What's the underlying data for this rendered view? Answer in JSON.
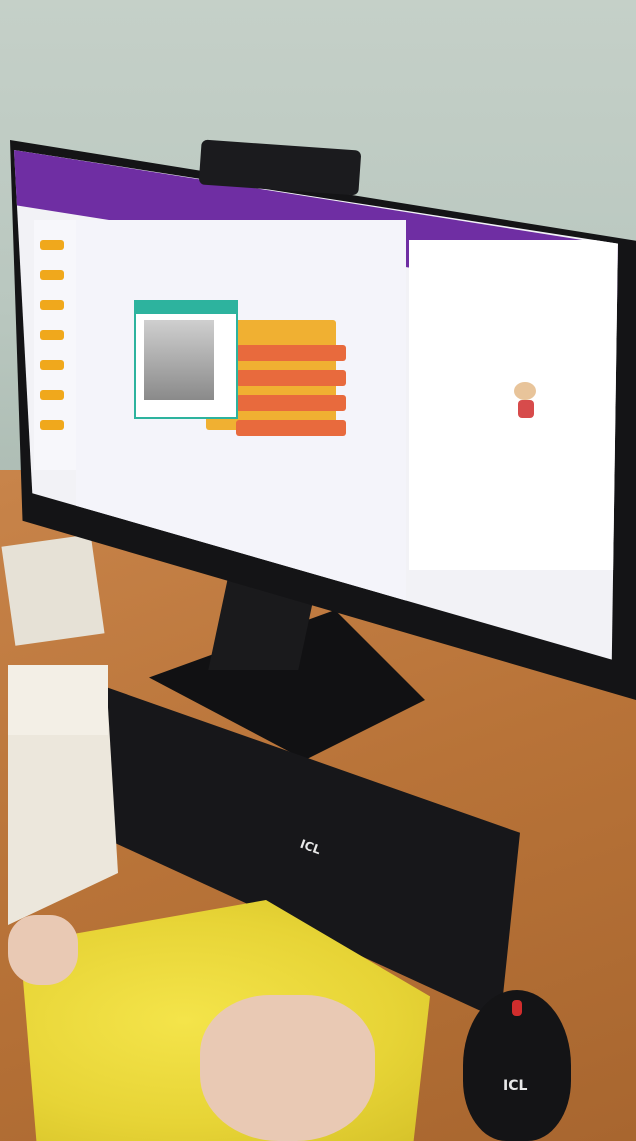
{
  "scene": {
    "keyboard_brand": "ICL",
    "mouse_brand": "ICL"
  },
  "colors": {
    "scratch_purple": "#6f2ea3",
    "block_orange": "#f0a81c",
    "cloth_yellow": "#e7d436",
    "desk": "#b87338",
    "wall": "#bcc9c1"
  },
  "icons": [
    "webcam-icon",
    "sprite-bear-icon",
    "video-dialog-icon"
  ]
}
